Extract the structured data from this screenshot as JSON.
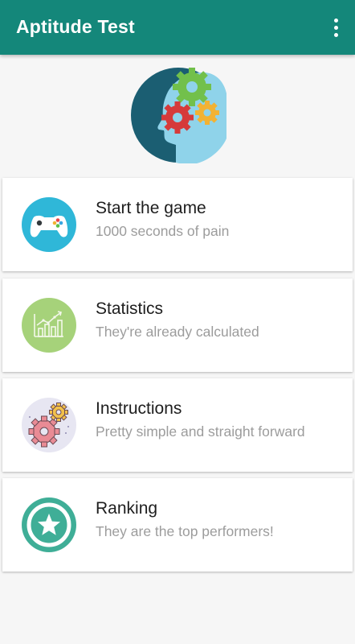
{
  "appbar": {
    "title": "Aptitude Test",
    "menu_icon": "more-vert-icon",
    "color": "#14877a"
  },
  "header_image": {
    "icon": "head-with-gears-icon"
  },
  "menu": {
    "items": [
      {
        "title": "Start the game",
        "subtitle": "1000 seconds of pain",
        "icon": "gamepad-icon",
        "color": "#2fb7d8"
      },
      {
        "title": "Statistics",
        "subtitle": "They're already calculated",
        "icon": "chart-icon",
        "color": "#a6d27a"
      },
      {
        "title": "Instructions",
        "subtitle": "Pretty simple and straight forward",
        "icon": "gears-icon",
        "color": "#e7e6f2"
      },
      {
        "title": "Ranking",
        "subtitle": "They are the top performers!",
        "icon": "star-badge-icon",
        "color": "#3fae97"
      }
    ]
  }
}
